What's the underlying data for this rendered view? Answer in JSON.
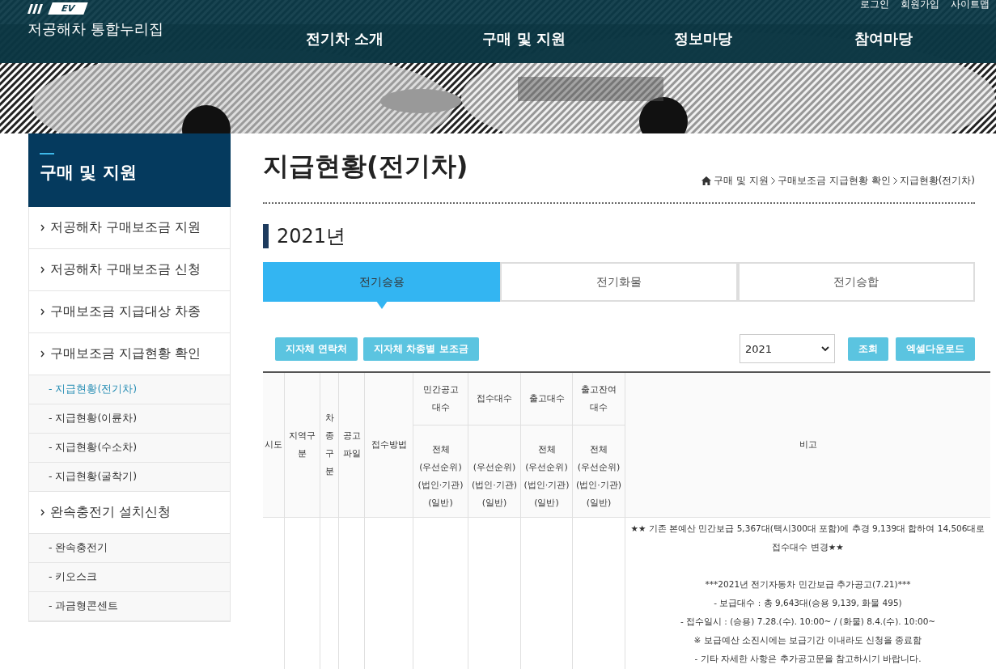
{
  "header": {
    "logo_badge": "EV",
    "site_title": "저공해차 통합누리집",
    "utility_links": [
      "로그인",
      "회원가입",
      "사이트맵"
    ],
    "nav": [
      "전기차 소개",
      "구매 및 지원",
      "정보마당",
      "참여마당"
    ]
  },
  "sidebar": {
    "title": "구매 및 지원",
    "items": [
      {
        "label": "저공해차 구매보조금 지원",
        "selected": false
      },
      {
        "label": "저공해차 구매보조금 신청",
        "selected": false
      },
      {
        "label": "구매보조금 지급대상 차종",
        "selected": false
      },
      {
        "label": "구매보조금 지급현황 확인",
        "selected": false,
        "children": [
          {
            "label": "- 지급현황(전기차)",
            "selected": true
          },
          {
            "label": "- 지급현황(이륜차)",
            "selected": false
          },
          {
            "label": "- 지급현황(수소차)",
            "selected": false
          },
          {
            "label": "- 지급현황(굴착기)",
            "selected": false
          }
        ]
      },
      {
        "label": "완속충전기 설치신청",
        "selected": false,
        "children": [
          {
            "label": "- 완속충전기",
            "selected": false
          },
          {
            "label": "- 키오스크",
            "selected": false
          },
          {
            "label": "- 과금형콘센트",
            "selected": false
          }
        ]
      }
    ]
  },
  "page_title": "지급현황(전기차)",
  "breadcrumb": [
    "구매 및 지원",
    "구매보조금 지급현황 확인",
    "지급현황(전기차)"
  ],
  "section_title": "2021년",
  "tabs": [
    {
      "label": "전기승용",
      "selected": true
    },
    {
      "label": "전기화물",
      "selected": false
    },
    {
      "label": "전기승합",
      "selected": false
    }
  ],
  "toolbar": {
    "left_buttons": [
      "지자체 연락처",
      "지자체 차종별 보조금"
    ],
    "year_select": "2021",
    "right_buttons": [
      "조회",
      "엑셀다운로드"
    ]
  },
  "table": {
    "columns": [
      {
        "label": "시도"
      },
      {
        "label": "지역구\n분"
      },
      {
        "label": "차\n종\n구\n분"
      },
      {
        "label": "공고\n파일"
      },
      {
        "label": "접수방법"
      },
      {
        "label": "민간공고\n대수",
        "lines": [
          "전체",
          "(우선순위)",
          "(법인·기관)",
          "(일반)"
        ]
      },
      {
        "label": "접수대수",
        "lines": [
          "(우선순위)",
          "(법인·기관)",
          "(일반)"
        ]
      },
      {
        "label": "출고대수",
        "lines": [
          "전체",
          "(우선순위)",
          "(법인·기관)",
          "(일반)"
        ]
      },
      {
        "label": "출고잔여\n대수",
        "lines": [
          "전체",
          "(우선순위)",
          "(법인·기관)",
          "(일반)"
        ]
      },
      {
        "label": "비고"
      }
    ],
    "remarks": {
      "notice": "★★ 기존 본예산 민간보급 5,367대(택시300대 포함)에 추경 9,139대 합하여 14,506대로 접수대수 변경★★",
      "announcement": [
        "***2021년 전기자동차 민간보급 추가공고(7.21)***",
        "- 보급대수 : 총 9,643대(승용 9,139, 화물 495)",
        "- 접수일시 : (승용) 7.28.(수). 10:00~ / (화물) 8.4.(수). 10:00~",
        "※ 보급예산 소진시에는 보급기간 이내라도 신청을 종료함",
        "- 기타 자세한 사항은 추가공고문을 참고하시기 바랍니다."
      ]
    }
  }
}
